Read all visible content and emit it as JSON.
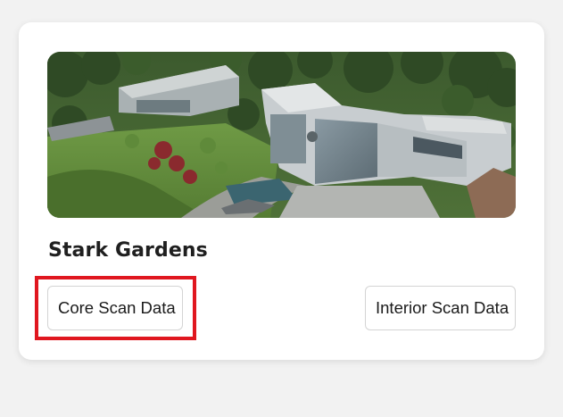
{
  "card": {
    "title": "Stark Gardens",
    "image_alt": "Aerial view of a modern compound surrounded by forest"
  },
  "actions": {
    "core_label": "Core Scan Data",
    "interior_label": "Interior Scan Data"
  },
  "colors": {
    "page_background": "#f2f2f2",
    "card_background": "#ffffff",
    "button_border": "#d4d4d4",
    "highlight": "#e0171f"
  }
}
